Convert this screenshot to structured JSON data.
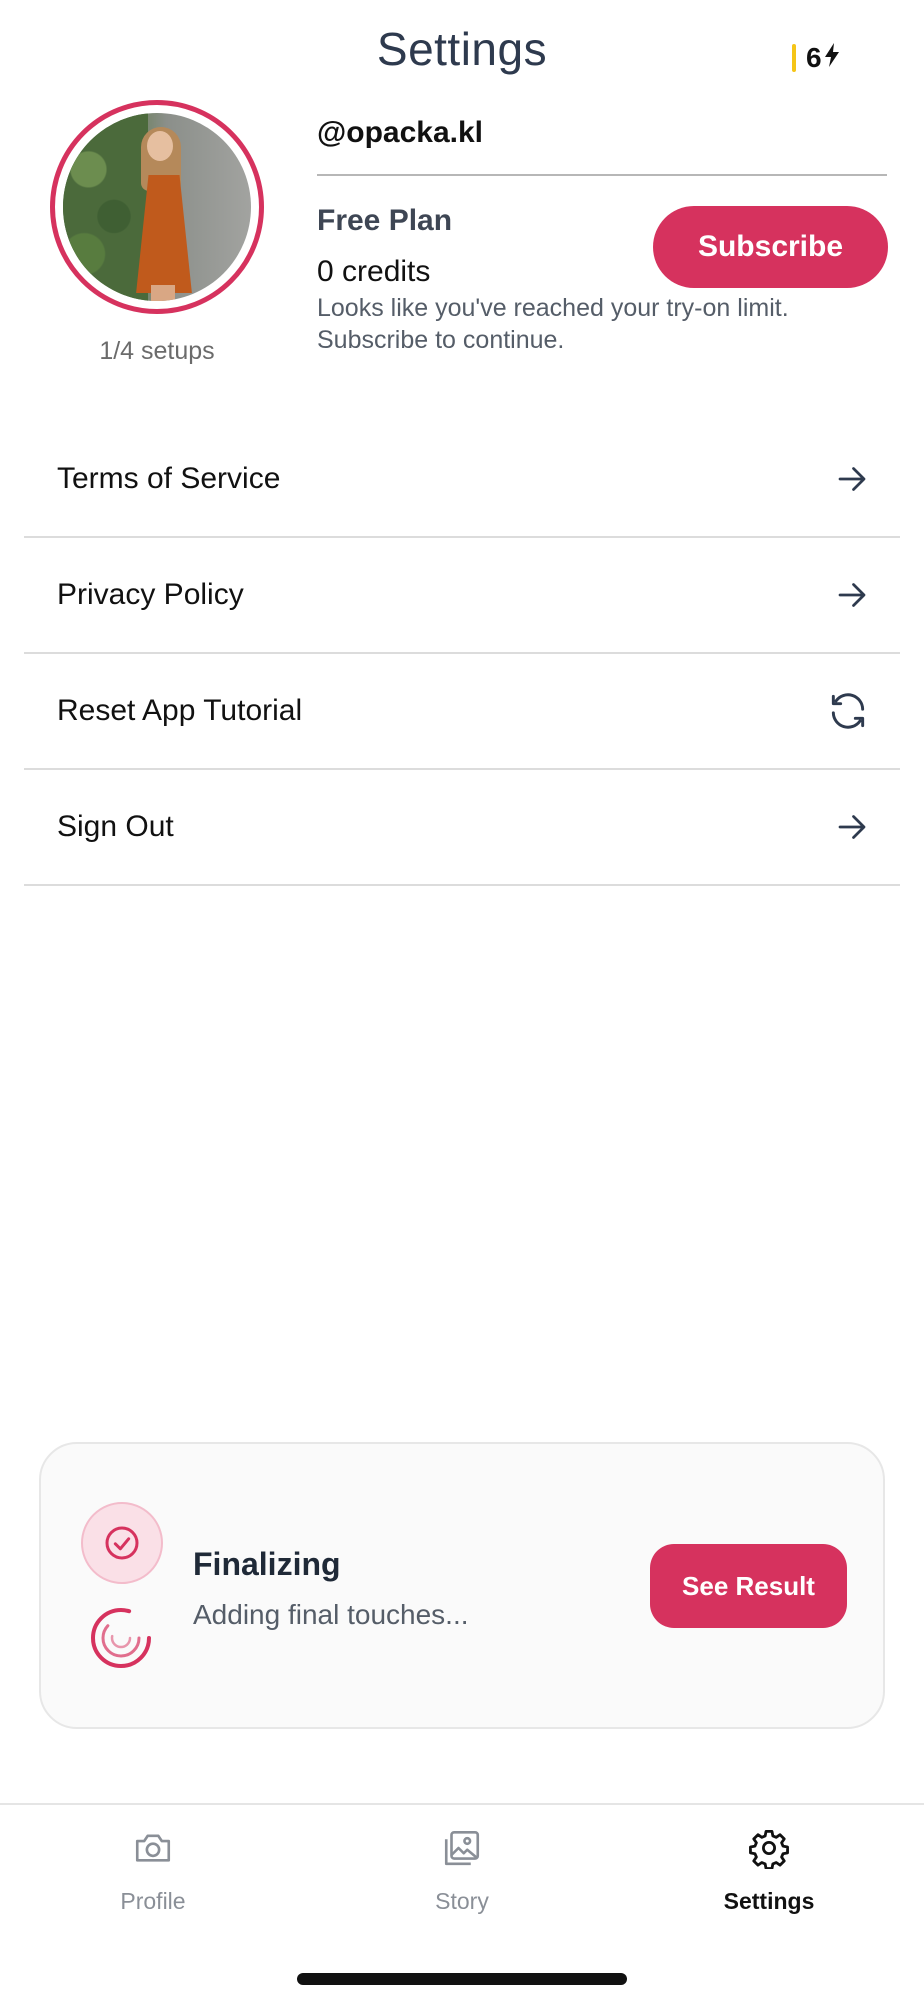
{
  "header": {
    "title": "Settings"
  },
  "credit_badge": {
    "value": "6",
    "icon": "bolt-icon",
    "accent": "#f5c518"
  },
  "profile": {
    "setups": "1/4 setups",
    "username": "@opacka.kl",
    "plan": "Free Plan",
    "credits": "0 credits",
    "limit_message": "Looks like you've reached your try-on limit. Subscribe to continue.",
    "subscribe_label": "Subscribe"
  },
  "menu": {
    "items": [
      {
        "label": "Terms of Service",
        "icon": "arrow-right-icon"
      },
      {
        "label": "Privacy Policy",
        "icon": "arrow-right-icon"
      },
      {
        "label": "Reset App Tutorial",
        "icon": "refresh-icon"
      },
      {
        "label": "Sign Out",
        "icon": "arrow-right-icon"
      }
    ]
  },
  "progress_toast": {
    "title": "Finalizing",
    "subtitle": "Adding final touches...",
    "button_label": "See Result"
  },
  "tabbar": {
    "tabs": [
      {
        "label": "Profile",
        "icon": "camera-icon",
        "active": false
      },
      {
        "label": "Story",
        "icon": "gallery-icon",
        "active": false
      },
      {
        "label": "Settings",
        "icon": "gear-icon",
        "active": true
      }
    ]
  },
  "colors": {
    "brand": "#d6325e",
    "text_muted": "#555d68"
  }
}
